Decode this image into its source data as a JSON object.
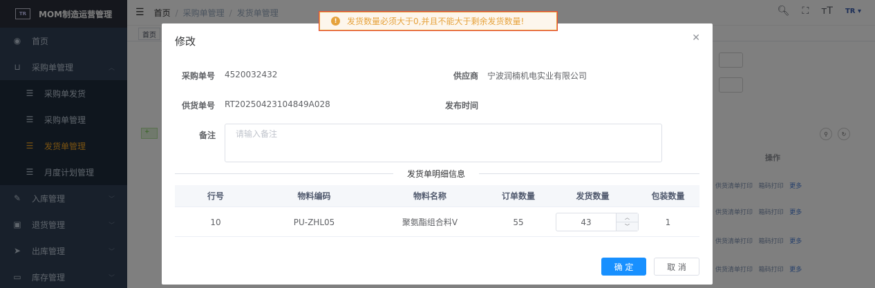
{
  "sidebar": {
    "logo_text": "MOM制造运营管理",
    "items": [
      {
        "label": "首页",
        "icon": "dashboard-icon"
      },
      {
        "label": "采购单管理",
        "icon": "cart-icon"
      },
      {
        "label": "采购单发货",
        "icon": "list-icon"
      },
      {
        "label": "采购单管理",
        "icon": "list-icon"
      },
      {
        "label": "发货单管理",
        "icon": "list-icon",
        "active": true
      },
      {
        "label": "月度计划管理",
        "icon": "list-icon"
      },
      {
        "label": "入库管理",
        "icon": "edit-icon"
      },
      {
        "label": "退货管理",
        "icon": "box-icon"
      },
      {
        "label": "出库管理",
        "icon": "send-icon"
      },
      {
        "label": "库存管理",
        "icon": "monitor-icon"
      }
    ]
  },
  "header": {
    "breadcrumb": [
      "首页",
      "采购单管理",
      "发货单管理"
    ]
  },
  "tags": {
    "home": "首页"
  },
  "toast": {
    "message": "发货数量必须大于0,并且不能大于剩余发货数量!",
    "color": "#e6a23c"
  },
  "dialog": {
    "title": "修改",
    "po_label": "采购单号",
    "po_value": "4520032432",
    "supplier_label": "供应商",
    "supplier_value": "宁波润楠机电实业有限公司",
    "delivery_label": "供货单号",
    "delivery_value": "RT20250423104849A028",
    "publish_label": "发布时间",
    "remark_label": "备注",
    "remark_placeholder": "请输入备注",
    "section_title": "发货单明细信息",
    "columns": [
      "行号",
      "物料编码",
      "物料名称",
      "订单数量",
      "发货数量",
      "包装数量"
    ],
    "row": {
      "line_no": "10",
      "material_code": "PU-ZHL05",
      "material_name": "聚氨酯组合料V",
      "order_qty": "55",
      "ship_qty": "43",
      "pack_qty": "1"
    },
    "confirm_label": "确 定",
    "cancel_label": "取 消"
  },
  "background": {
    "ops_header": "操作",
    "op_print_list": "供货清单打印",
    "op_print_box": "箱码打印",
    "op_more": "更多"
  },
  "colors": {
    "primary": "#1890ff",
    "sidebar": "#304156",
    "active_menu": "#f5a623",
    "warning": "#e6a23c"
  }
}
